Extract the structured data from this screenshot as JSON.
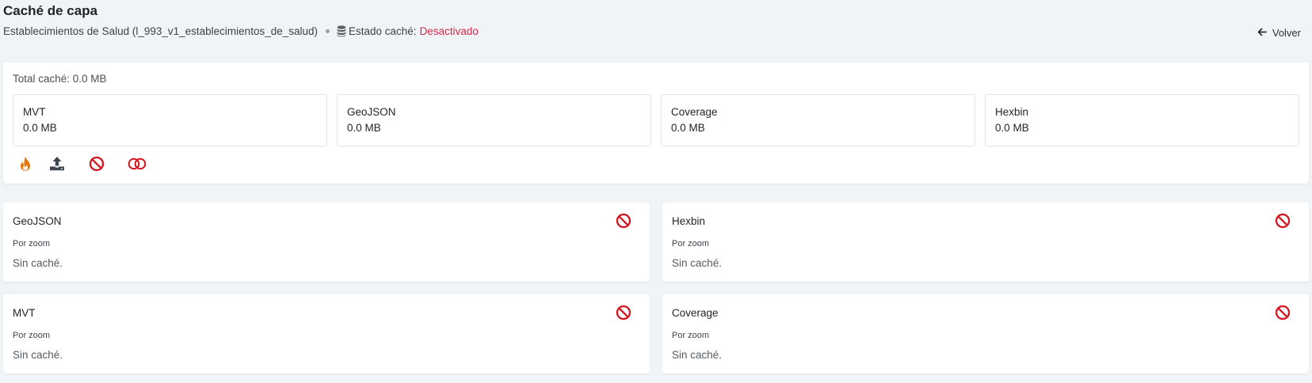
{
  "page": {
    "title": "Caché de capa",
    "layer_name": "Establecimientos de Salud (l_993_v1_establecimientos_de_salud)",
    "cache_status_label": "Estado caché:",
    "cache_status_value": "Desactivado",
    "back_label": "Volver"
  },
  "summary": {
    "total_label": "Total caché: 0.0 MB",
    "stats": [
      {
        "name": "MVT",
        "value": "0.0 MB"
      },
      {
        "name": "GeoJSON",
        "value": "0.0 MB"
      },
      {
        "name": "Coverage",
        "value": "0.0 MB"
      },
      {
        "name": "Hexbin",
        "value": "0.0 MB"
      }
    ],
    "actions": [
      {
        "icon": "flame-icon",
        "color": "#e8770d"
      },
      {
        "icon": "upload-icon",
        "color": "#3d4650"
      },
      {
        "icon": "ban-icon",
        "color": "#d6141e"
      },
      {
        "icon": "toggle-icon",
        "color": "#d6141e"
      }
    ]
  },
  "cache_types": [
    {
      "title": "GeoJSON",
      "subtitle": "Por zoom",
      "empty": "Sin caché."
    },
    {
      "title": "Hexbin",
      "subtitle": "Por zoom",
      "empty": "Sin caché."
    },
    {
      "title": "MVT",
      "subtitle": "Por zoom",
      "empty": "Sin caché."
    },
    {
      "title": "Coverage",
      "subtitle": "Por zoom",
      "empty": "Sin caché."
    }
  ],
  "colors": {
    "background": "#f1f4f7",
    "status_off": "#d6264d",
    "danger": "#d6141e",
    "flame": "#e8770d"
  }
}
